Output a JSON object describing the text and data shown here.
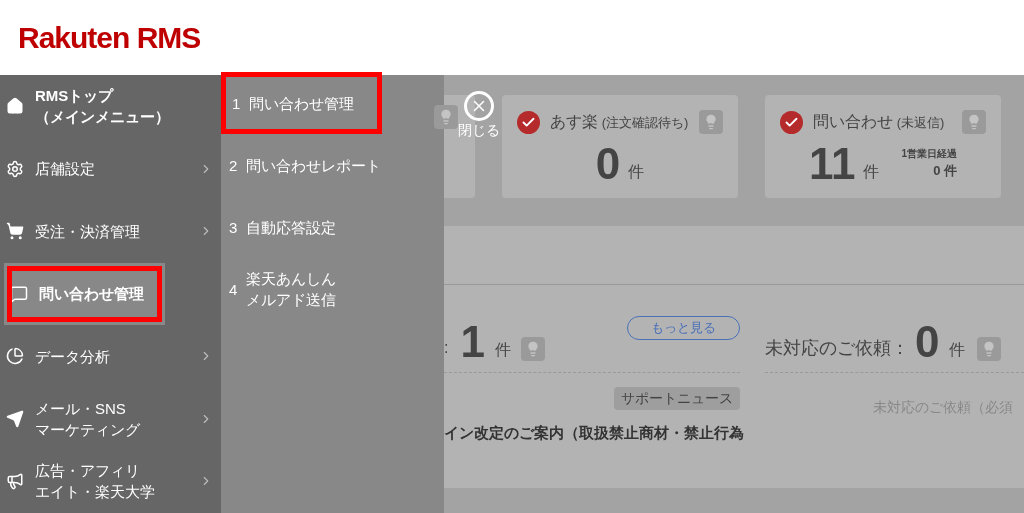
{
  "logo": {
    "text": "Rakuten RMS"
  },
  "sidebar": {
    "items": [
      {
        "lines": [
          "RMSトップ",
          "（メインメニュー）"
        ],
        "arrow": false,
        "selected": false,
        "highlighted": false
      },
      {
        "lines": [
          "店舗設定"
        ],
        "arrow": true,
        "selected": false,
        "highlighted": false
      },
      {
        "lines": [
          "受注・決済管理"
        ],
        "arrow": true,
        "selected": false,
        "highlighted": false
      },
      {
        "lines": [
          "問い合わせ管理"
        ],
        "arrow": false,
        "selected": true,
        "highlighted": true
      },
      {
        "lines": [
          "データ分析"
        ],
        "arrow": true,
        "selected": false,
        "highlighted": false
      },
      {
        "lines": [
          "メール・SNS",
          "マーケティング"
        ],
        "arrow": true,
        "selected": false,
        "highlighted": false
      },
      {
        "lines": [
          "広告・アフィリ",
          "エイト・楽天大学"
        ],
        "arrow": true,
        "selected": false,
        "highlighted": false
      }
    ]
  },
  "submenu": {
    "items": [
      {
        "number": "1",
        "lines": [
          "問い合わせ管理"
        ],
        "highlighted": true
      },
      {
        "number": "2",
        "lines": [
          "問い合わせレポート"
        ],
        "highlighted": false
      },
      {
        "number": "3",
        "lines": [
          "自動応答設定"
        ],
        "highlighted": false
      },
      {
        "number": "4",
        "lines": [
          "楽天あんしん",
          "メルアド送信"
        ],
        "highlighted": false
      }
    ]
  },
  "close_button": {
    "label": "閉じる"
  },
  "top_cards": [
    {
      "kind": "partial"
    },
    {
      "kind": "card",
      "title": "あす楽",
      "subtitle": "(注文確認待ち)",
      "count": "0",
      "unit": "件"
    },
    {
      "kind": "card",
      "title": "問い合わせ",
      "subtitle": "(未返信)",
      "count": "11",
      "unit": "件",
      "extra_label": "1営業日経過",
      "extra_value": "0 件"
    }
  ],
  "left_panel": {
    "colon": ":",
    "count": "1",
    "unit": "件",
    "more_button": "もっと見る",
    "tag": "サポートニュース",
    "news": "イン改定のご案内（取扱禁止商材・禁止行為"
  },
  "right_panel": {
    "label": "未対応のご依頼：",
    "count": "0",
    "unit": "件",
    "note": "未対応のご依頼（必須"
  }
}
